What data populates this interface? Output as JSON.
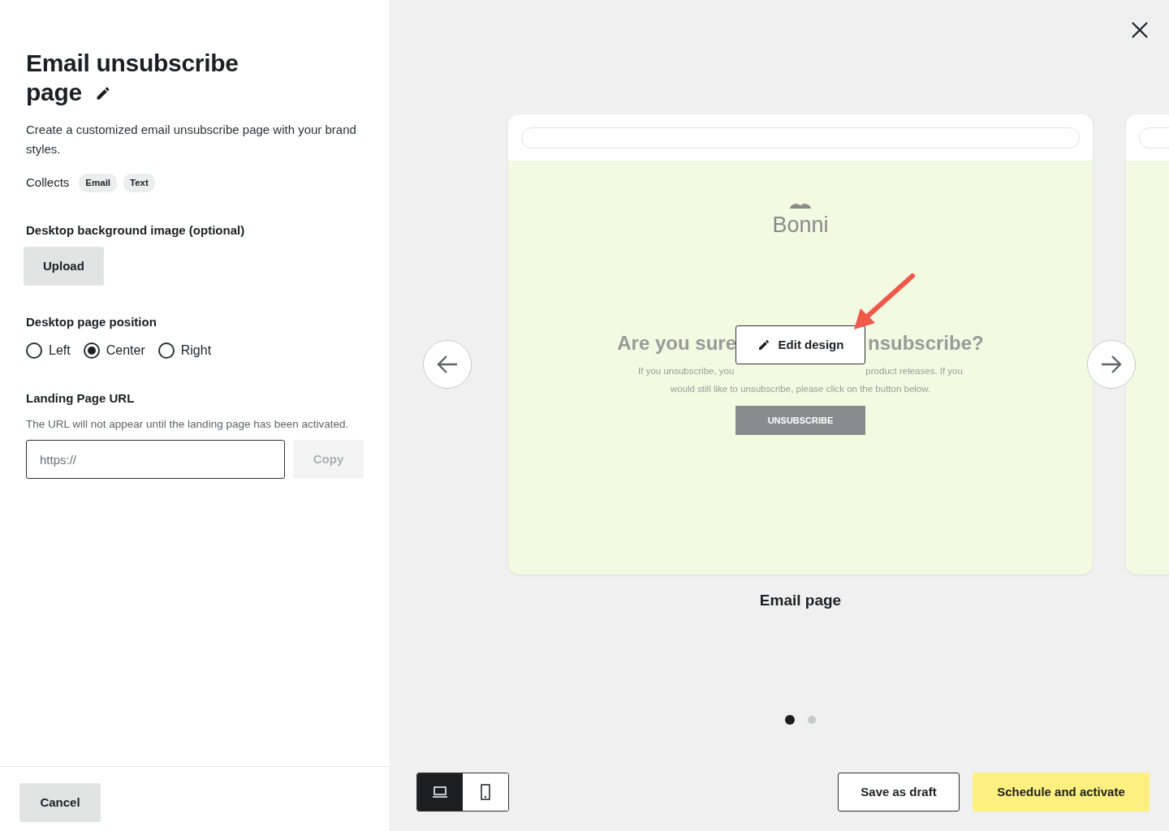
{
  "title_lines": [
    "Email unsubscribe",
    "page"
  ],
  "description": "Create a customized email unsubscribe page with your brand styles.",
  "collects": {
    "label": "Collects",
    "tags": [
      "Email",
      "Text"
    ]
  },
  "background_image": {
    "label": "Desktop background image (optional)",
    "button": "Upload"
  },
  "page_position": {
    "label": "Desktop page position",
    "options": [
      {
        "label": "Left",
        "selected": false
      },
      {
        "label": "Center",
        "selected": true
      },
      {
        "label": "Right",
        "selected": false
      }
    ]
  },
  "landing_url": {
    "label": "Landing Page URL",
    "help": "The URL will not appear until the landing page has been activated.",
    "placeholder": "https://",
    "copy_button": "Copy",
    "copy_disabled": true
  },
  "cancel_button": "Cancel",
  "preview": {
    "brand": "Bonni",
    "heading_parts": [
      "Are you sure",
      "nsubscribe?"
    ],
    "body_line_parts": [
      "If you unsubscribe, you",
      "product releases. If you"
    ],
    "body_line": "would still like to unsubscribe, please click on the button below.",
    "unsubscribe_button": "UNSUBSCRIBE",
    "edit_button": "Edit design",
    "caption": "Email page",
    "dots": [
      {
        "selected": true
      },
      {
        "selected": false
      }
    ]
  },
  "device_toggle": [
    {
      "kind": "desktop",
      "selected": true
    },
    {
      "kind": "mobile",
      "selected": false
    }
  ],
  "actions": {
    "draft": "Save as draft",
    "primary": "Schedule and activate"
  }
}
